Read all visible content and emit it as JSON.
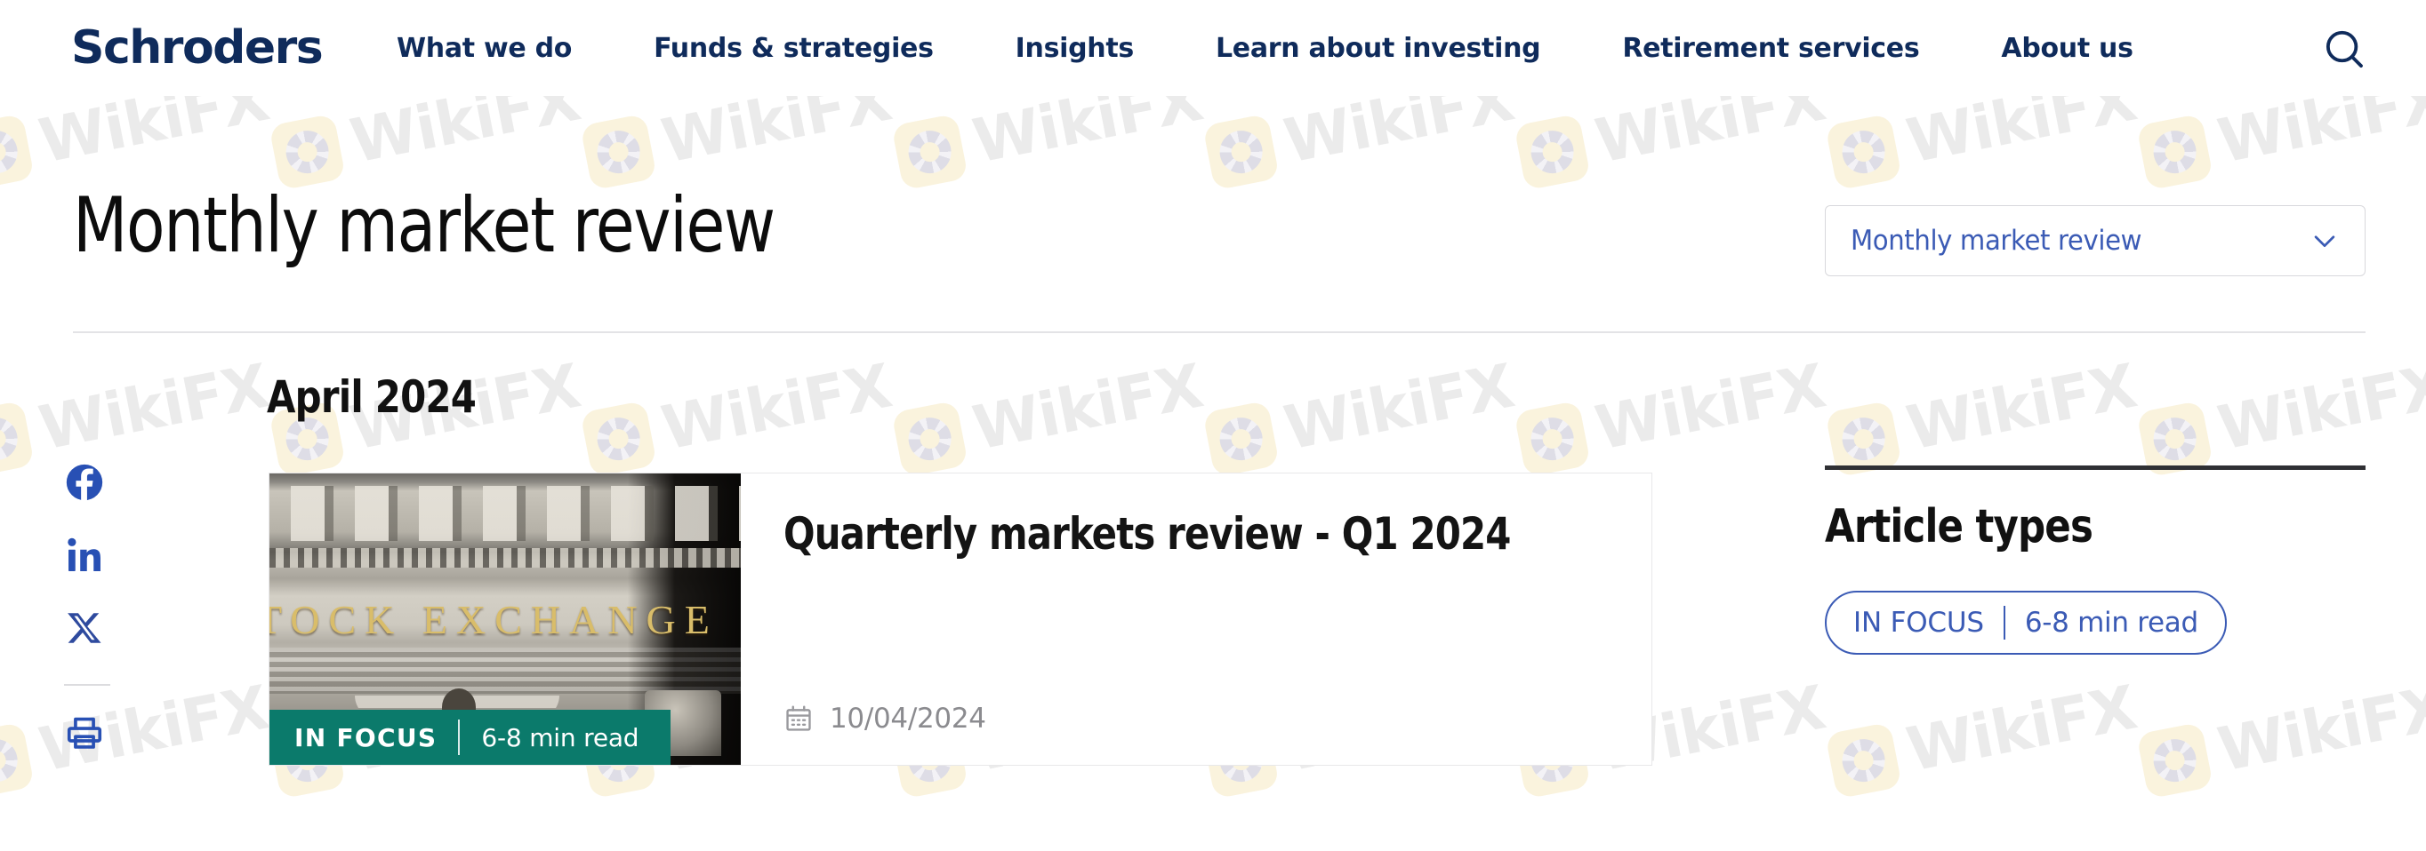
{
  "header": {
    "brand": "Schroders",
    "nav_items": [
      {
        "label": "What we do"
      },
      {
        "label": "Funds & strategies"
      },
      {
        "label": "Insights"
      },
      {
        "label": "Learn about investing"
      },
      {
        "label": "Retirement services"
      },
      {
        "label": "About us"
      }
    ],
    "search_icon": "search-icon"
  },
  "page": {
    "title": "Monthly market review",
    "category_select": {
      "value": "Monthly market review",
      "chevron_icon": "chevron-down-icon"
    }
  },
  "social": {
    "items": [
      {
        "name": "facebook-icon",
        "label": "Facebook"
      },
      {
        "name": "linkedin-icon",
        "label": "LinkedIn"
      },
      {
        "name": "x-twitter-icon",
        "label": "X"
      },
      {
        "name": "print-icon",
        "label": "Print"
      }
    ]
  },
  "main": {
    "month_heading": "April 2024",
    "articles": [
      {
        "title": "Quarterly markets review - Q1 2024",
        "date": "10/04/2024",
        "date_icon": "calendar-icon",
        "badge_type": "IN FOCUS",
        "badge_read_time": "6-8 min read",
        "thumbnail_alt": "Stock exchange building facade",
        "thumbnail_text": "TOCK EXCHANGE"
      }
    ]
  },
  "sidebar": {
    "heading": "Article types",
    "filters": [
      {
        "type_label": "IN FOCUS",
        "read_time": "6-8 min read"
      }
    ]
  },
  "watermark": {
    "text": "WikiFX"
  },
  "colors": {
    "brand_navy": "#0f2b5b",
    "link_blue": "#3b5bb5",
    "badge_teal": "#0b7a6b",
    "text_dark": "#111111",
    "muted": "#8b8b8f",
    "rule_dark": "#2f3034",
    "border_light": "#e8e8ea"
  }
}
